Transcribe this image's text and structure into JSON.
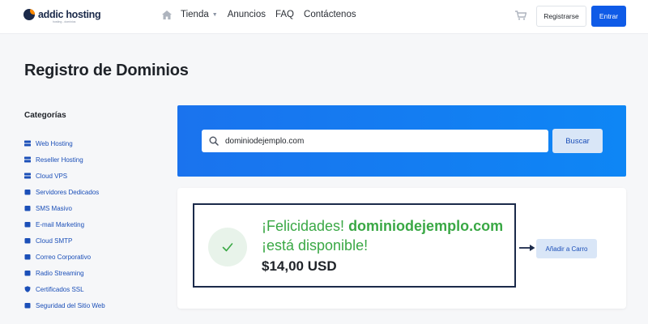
{
  "brand": {
    "name": "addic hosting",
    "tagline": "hosting - dominios"
  },
  "nav": {
    "items": [
      {
        "label": "Tienda",
        "has_dropdown": true
      },
      {
        "label": "Anuncios"
      },
      {
        "label": "FAQ"
      },
      {
        "label": "Contáctenos"
      }
    ]
  },
  "header_actions": {
    "register_label": "Registrarse",
    "login_label": "Entrar"
  },
  "page": {
    "title": "Registro de Dominios"
  },
  "sidebar": {
    "title": "Categorías",
    "items": [
      {
        "label": "Web Hosting",
        "icon": "server-icon"
      },
      {
        "label": "Reseller Hosting",
        "icon": "server-icon"
      },
      {
        "label": "Cloud VPS",
        "icon": "server-icon"
      },
      {
        "label": "Servidores Dedicados",
        "icon": "box-icon"
      },
      {
        "label": "SMS Masivo",
        "icon": "box-icon"
      },
      {
        "label": "E-mail Marketing",
        "icon": "box-icon"
      },
      {
        "label": "Cloud SMTP",
        "icon": "box-icon"
      },
      {
        "label": "Correo Corporativo",
        "icon": "box-icon"
      },
      {
        "label": "Radio Streaming",
        "icon": "box-icon"
      },
      {
        "label": "Certificados SSL",
        "icon": "shield-icon"
      },
      {
        "label": "Seguridad del Sitio Web",
        "icon": "box-icon"
      }
    ]
  },
  "search": {
    "value": "dominiodejemplo.com",
    "button_label": "Buscar"
  },
  "result": {
    "prefix": "¡Felicidades!",
    "domain": "dominiodejemplo.com",
    "status_text": "¡está disponible!",
    "price": "$14,00 USD",
    "add_to_cart_label": "Añadir a Carro"
  },
  "colors": {
    "accent": "#0f5be7",
    "success": "#3aa845",
    "link": "#1b4fb8",
    "highlight_border": "#1b2a4a"
  }
}
